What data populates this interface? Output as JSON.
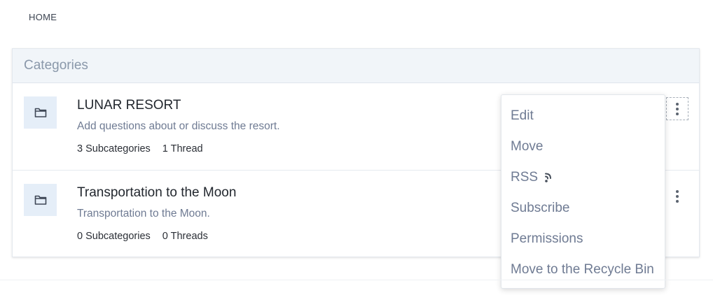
{
  "breadcrumb": {
    "home": "HOME"
  },
  "panel": {
    "title": "Categories"
  },
  "categories": [
    {
      "title": "LUNAR RESORT",
      "description": "Add questions about or discuss the resort.",
      "subcategories": "3 Subcategories",
      "threads": "1 Thread",
      "icon": "folder-icon"
    },
    {
      "title": "Transportation to the Moon",
      "description": "Transportation to the Moon.",
      "subcategories": "0 Subcategories",
      "threads": "0 Threads",
      "icon": "folder-icon"
    }
  ],
  "menu": {
    "items": [
      "Edit",
      "Move",
      "RSS",
      "Subscribe",
      "Permissions",
      "Move to the Recycle Bin"
    ],
    "rss_icon": "rss-icon"
  },
  "colors": {
    "accent_text": "#6f7b93",
    "header_bg": "#f1f5f9",
    "icon_bg": "#e5eef8"
  }
}
